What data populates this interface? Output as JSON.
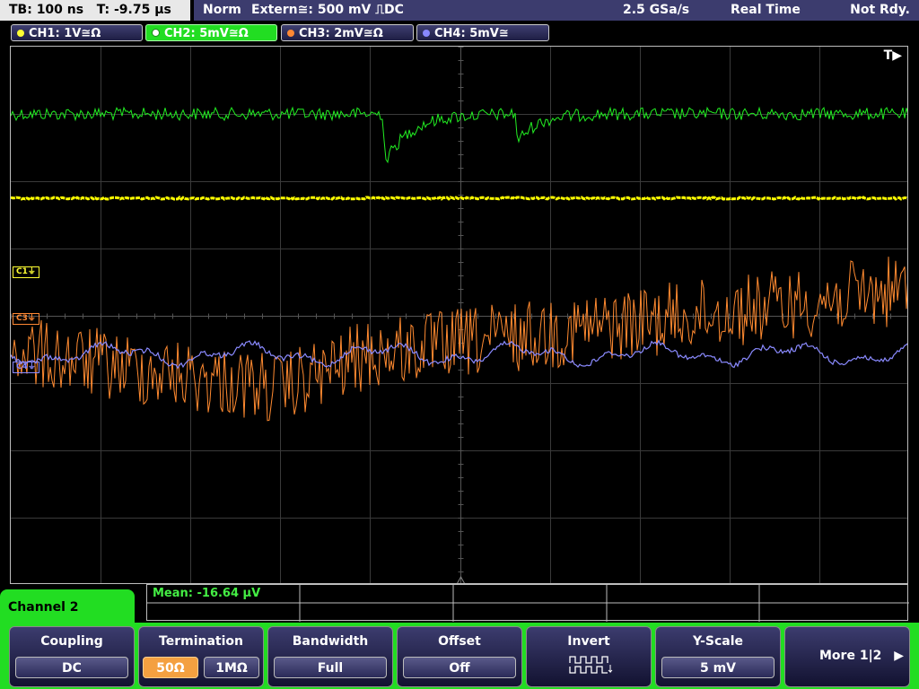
{
  "status": {
    "timebase": "TB: 100 ns   T: -9.75 µs",
    "mode": "Norm",
    "trigger": "Extern≅: 500 mV ⎍DC",
    "sample_rate": "2.5 GSa/s",
    "acq_mode": "Real Time",
    "state": "Not Rdy."
  },
  "channels": [
    {
      "label": "CH1: 1V≅Ω",
      "color": "#ffff33",
      "active": false
    },
    {
      "label": "CH2: 5mV≅Ω",
      "color": "#33ee33",
      "active": true
    },
    {
      "label": "CH3: 2mV≅Ω",
      "color": "#ff8833",
      "active": false
    },
    {
      "label": "CH4: 5mV≅",
      "color": "#8888ff",
      "active": false
    }
  ],
  "trace_markers": {
    "c1": "C1",
    "c3": "C3",
    "c4": "C4",
    "trigger_flag": "T▶"
  },
  "measurement": {
    "text": "Mean: -16.64 µV"
  },
  "channel_panel": {
    "title": "Channel 2"
  },
  "softkeys": {
    "coupling": {
      "title": "Coupling",
      "value": "DC"
    },
    "termination": {
      "title": "Termination",
      "opt1": "50Ω",
      "opt2": "1MΩ"
    },
    "bandwidth": {
      "title": "Bandwidth",
      "value": "Full"
    },
    "offset": {
      "title": "Offset",
      "value": "Off"
    },
    "invert": {
      "title": "Invert"
    },
    "yscale": {
      "title": "Y-Scale",
      "value": "5 mV"
    },
    "more": {
      "label": "More 1|2"
    }
  }
}
